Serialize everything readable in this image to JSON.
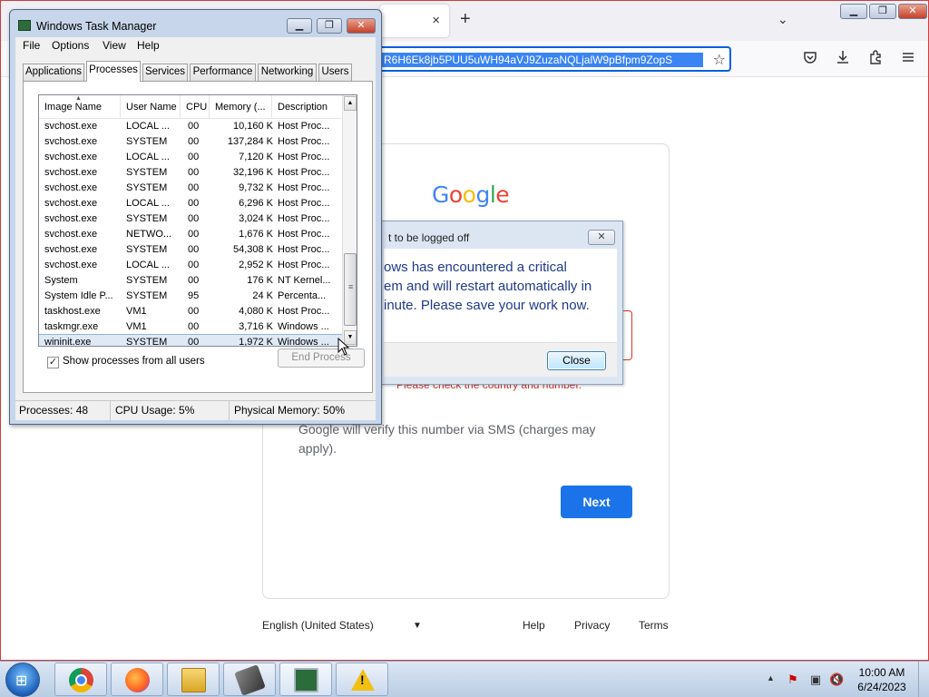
{
  "firefox": {
    "url": "R6H6Ek8jb5PUU5uWH94aVJ9ZuzaNQLjalW9pBfpm9ZopS",
    "tab_close_glyph": "×",
    "new_tab_glyph": "+",
    "tablist_glyph": "⌄",
    "window_buttons": {
      "minimize": "▁",
      "maximize": "❐",
      "close": "✕"
    },
    "toolbar_icons": [
      "pocket-icon",
      "download-icon",
      "extensions-icon",
      "menu-icon"
    ]
  },
  "google": {
    "logo_letters": [
      {
        "ch": "G",
        "color": "#4285f4"
      },
      {
        "ch": "o",
        "color": "#ea4335"
      },
      {
        "ch": "o",
        "color": "#fbbc05"
      },
      {
        "ch": "g",
        "color": "#4285f4"
      },
      {
        "ch": "l",
        "color": "#34a853"
      },
      {
        "ch": "e",
        "color": "#ea4335"
      }
    ],
    "error_text": "Please check the country and number.",
    "sms_text": "Google will verify this number via SMS (charges may apply).",
    "next_label": "Next",
    "language": "English (United States)",
    "footer": {
      "help": "Help",
      "privacy": "Privacy",
      "terms": "Terms"
    }
  },
  "shutdown_dialog": {
    "title": "t to be logged off",
    "message": "ows has encountered a critical\nem and will restart automatically in\ninute. Please save your work now.",
    "close_label": "Close",
    "x_glyph": "✕"
  },
  "taskmgr": {
    "title": "Windows Task Manager",
    "window_buttons": {
      "minimize": "▁",
      "maximize": "❐",
      "close": "✕"
    },
    "menu": {
      "file": "File",
      "options": "Options",
      "view": "View",
      "help": "Help"
    },
    "tabs": {
      "applications": "Applications",
      "processes": "Processes",
      "services": "Services",
      "performance": "Performance",
      "networking": "Networking",
      "users": "Users"
    },
    "active_tab": "Processes",
    "columns": {
      "name": "Image Name",
      "user": "User Name",
      "cpu": "CPU",
      "memory": "Memory (...",
      "description": "Description"
    },
    "processes": [
      {
        "name": "svchost.exe",
        "user": "LOCAL ...",
        "cpu": "00",
        "memory": "10,160 K",
        "description": "Host Proc..."
      },
      {
        "name": "svchost.exe",
        "user": "SYSTEM",
        "cpu": "00",
        "memory": "137,284 K",
        "description": "Host Proc..."
      },
      {
        "name": "svchost.exe",
        "user": "LOCAL ...",
        "cpu": "00",
        "memory": "7,120 K",
        "description": "Host Proc..."
      },
      {
        "name": "svchost.exe",
        "user": "SYSTEM",
        "cpu": "00",
        "memory": "32,196 K",
        "description": "Host Proc..."
      },
      {
        "name": "svchost.exe",
        "user": "SYSTEM",
        "cpu": "00",
        "memory": "9,732 K",
        "description": "Host Proc..."
      },
      {
        "name": "svchost.exe",
        "user": "LOCAL ...",
        "cpu": "00",
        "memory": "6,296 K",
        "description": "Host Proc..."
      },
      {
        "name": "svchost.exe",
        "user": "SYSTEM",
        "cpu": "00",
        "memory": "3,024 K",
        "description": "Host Proc..."
      },
      {
        "name": "svchost.exe",
        "user": "NETWO...",
        "cpu": "00",
        "memory": "1,676 K",
        "description": "Host Proc..."
      },
      {
        "name": "svchost.exe",
        "user": "SYSTEM",
        "cpu": "00",
        "memory": "54,308 K",
        "description": "Host Proc..."
      },
      {
        "name": "svchost.exe",
        "user": "LOCAL ...",
        "cpu": "00",
        "memory": "2,952 K",
        "description": "Host Proc..."
      },
      {
        "name": "System",
        "user": "SYSTEM",
        "cpu": "00",
        "memory": "176 K",
        "description": "NT Kernel..."
      },
      {
        "name": "System Idle P...",
        "user": "SYSTEM",
        "cpu": "95",
        "memory": "24 K",
        "description": "Percenta..."
      },
      {
        "name": "taskhost.exe",
        "user": "VM1",
        "cpu": "00",
        "memory": "4,080 K",
        "description": "Host Proc..."
      },
      {
        "name": "taskmgr.exe",
        "user": "VM1",
        "cpu": "00",
        "memory": "3,716 K",
        "description": "Windows ..."
      },
      {
        "name": "wininit.exe",
        "user": "SYSTEM",
        "cpu": "00",
        "memory": "1,972 K",
        "description": "Windows ...",
        "selected": true
      }
    ],
    "show_all_label": "Show processes from all users",
    "show_all_checked": true,
    "end_process_label": "End Process",
    "status": {
      "processes": "Processes: 48",
      "cpu": "CPU Usage: 5%",
      "memory": "Physical Memory: 50%"
    }
  },
  "taskbar": {
    "apps": [
      "chrome-icon",
      "firefox-icon",
      "explorer-icon",
      "tool-icon",
      "taskmgr-icon",
      "warning-icon"
    ],
    "time": "10:00 AM",
    "date": "6/24/2023"
  }
}
